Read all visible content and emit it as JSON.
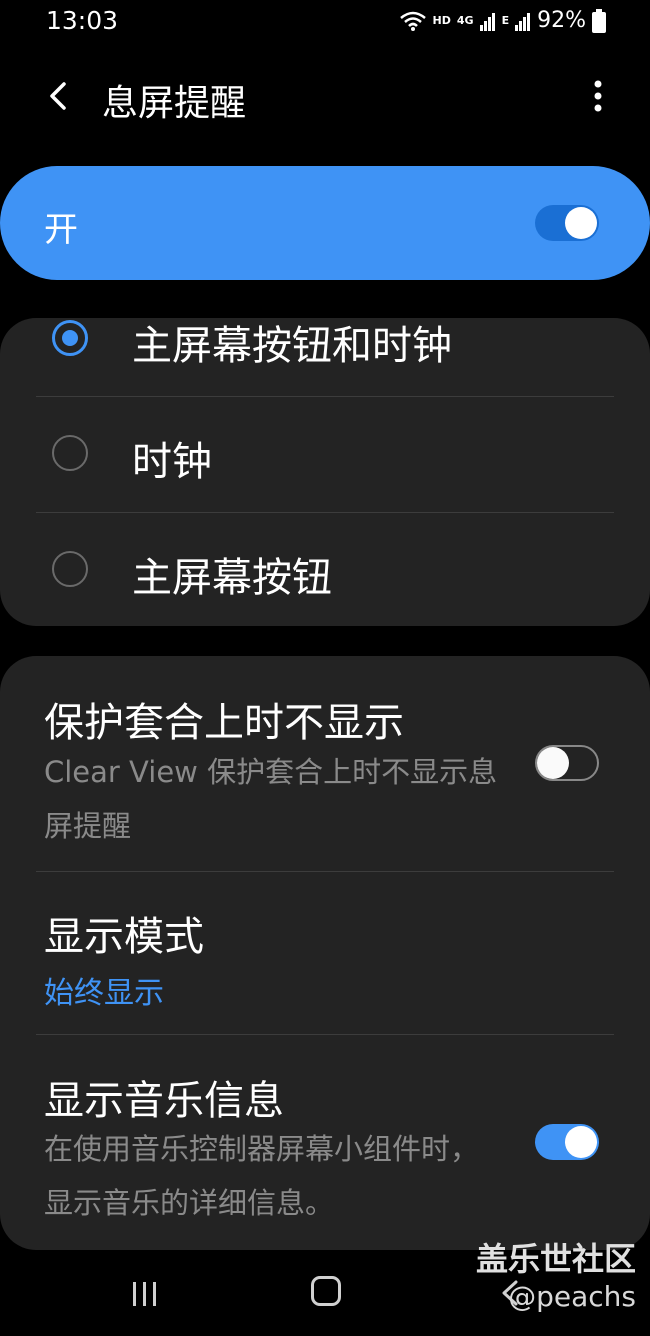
{
  "status_bar": {
    "time": "13:03",
    "network_hd": "HD",
    "network_4g": "4G",
    "network_e": "E",
    "battery_percent": "92%"
  },
  "app_bar": {
    "title": "息屏提醒"
  },
  "master_toggle": {
    "label": "开",
    "on": true
  },
  "style_options": [
    {
      "label": "主屏幕按钮和时钟",
      "selected": true
    },
    {
      "label": "时钟",
      "selected": false
    },
    {
      "label": "主屏幕按钮",
      "selected": false
    }
  ],
  "settings": {
    "cover": {
      "title": "保护套合上时不显示",
      "subtitle": "Clear View 保护套合上时不显示息屏提醒",
      "on": false
    },
    "display_mode": {
      "title": "显示模式",
      "value": "始终显示"
    },
    "music_info": {
      "title": "显示音乐信息",
      "subtitle": "在使用音乐控制器屏幕小组件时，显示音乐的详细信息。",
      "on": true
    }
  },
  "watermark": {
    "line1": "盖乐世社区",
    "line2": "@peachs"
  },
  "colors": {
    "accent": "#3f93f5",
    "card_bg": "#232323",
    "background": "#000000",
    "secondary_text": "#8a8a8a"
  }
}
